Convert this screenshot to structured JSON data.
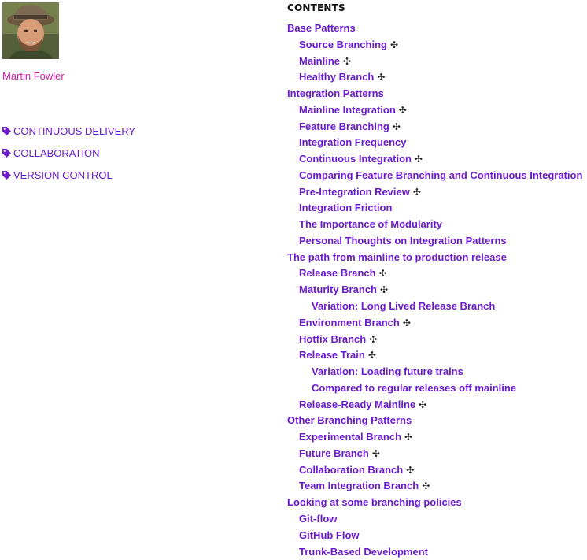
{
  "author": {
    "name": "Martin Fowler",
    "photo_icon": "author-photo"
  },
  "tags": [
    {
      "icon": "tag-icon",
      "label": "CONTINUOUS DELIVERY"
    },
    {
      "icon": "tag-icon",
      "label": "COLLABORATION"
    },
    {
      "icon": "tag-icon",
      "label": "VERSION CONTROL"
    }
  ],
  "contents": {
    "heading": "CONTENTS",
    "pattern_mark": "✣",
    "items": [
      {
        "label": "Base Patterns",
        "level": 1,
        "pattern": false
      },
      {
        "label": "Source Branching",
        "level": 2,
        "pattern": true
      },
      {
        "label": "Mainline",
        "level": 2,
        "pattern": true
      },
      {
        "label": "Healthy Branch",
        "level": 2,
        "pattern": true
      },
      {
        "label": "Integration Patterns",
        "level": 1,
        "pattern": false
      },
      {
        "label": "Mainline Integration",
        "level": 2,
        "pattern": true
      },
      {
        "label": "Feature Branching",
        "level": 2,
        "pattern": true
      },
      {
        "label": "Integration Frequency",
        "level": 2,
        "pattern": false
      },
      {
        "label": "Continuous Integration",
        "level": 2,
        "pattern": true
      },
      {
        "label": "Comparing Feature Branching and Continuous Integration",
        "level": 2,
        "pattern": false
      },
      {
        "label": "Pre-Integration Review",
        "level": 2,
        "pattern": true
      },
      {
        "label": "Integration Friction",
        "level": 2,
        "pattern": false
      },
      {
        "label": "The Importance of Modularity",
        "level": 2,
        "pattern": false
      },
      {
        "label": "Personal Thoughts on Integration Patterns",
        "level": 2,
        "pattern": false
      },
      {
        "label": "The path from mainline to production release",
        "level": 1,
        "pattern": false
      },
      {
        "label": "Release Branch",
        "level": 2,
        "pattern": true
      },
      {
        "label": "Maturity Branch",
        "level": 2,
        "pattern": true
      },
      {
        "label": "Variation: Long Lived Release Branch",
        "level": 3,
        "pattern": false
      },
      {
        "label": "Environment Branch",
        "level": 2,
        "pattern": true
      },
      {
        "label": "Hotfix Branch",
        "level": 2,
        "pattern": true
      },
      {
        "label": "Release Train",
        "level": 2,
        "pattern": true
      },
      {
        "label": "Variation: Loading future trains",
        "level": 3,
        "pattern": false
      },
      {
        "label": "Compared to regular releases off mainline",
        "level": 3,
        "pattern": false
      },
      {
        "label": "Release-Ready Mainline",
        "level": 2,
        "pattern": true
      },
      {
        "label": "Other Branching Patterns",
        "level": 1,
        "pattern": false
      },
      {
        "label": "Experimental Branch",
        "level": 2,
        "pattern": true
      },
      {
        "label": "Future Branch",
        "level": 2,
        "pattern": true
      },
      {
        "label": "Collaboration Branch",
        "level": 2,
        "pattern": true
      },
      {
        "label": "Team Integration Branch",
        "level": 2,
        "pattern": true
      },
      {
        "label": "Looking at some branching policies",
        "level": 1,
        "pattern": false
      },
      {
        "label": "Git-flow",
        "level": 2,
        "pattern": false
      },
      {
        "label": "GitHub Flow",
        "level": 2,
        "pattern": false
      },
      {
        "label": "Trunk-Based Development",
        "level": 2,
        "pattern": false
      }
    ]
  },
  "colors": {
    "link": "#6a1bcc",
    "author": "#cc1fa5",
    "heading": "#111111"
  }
}
